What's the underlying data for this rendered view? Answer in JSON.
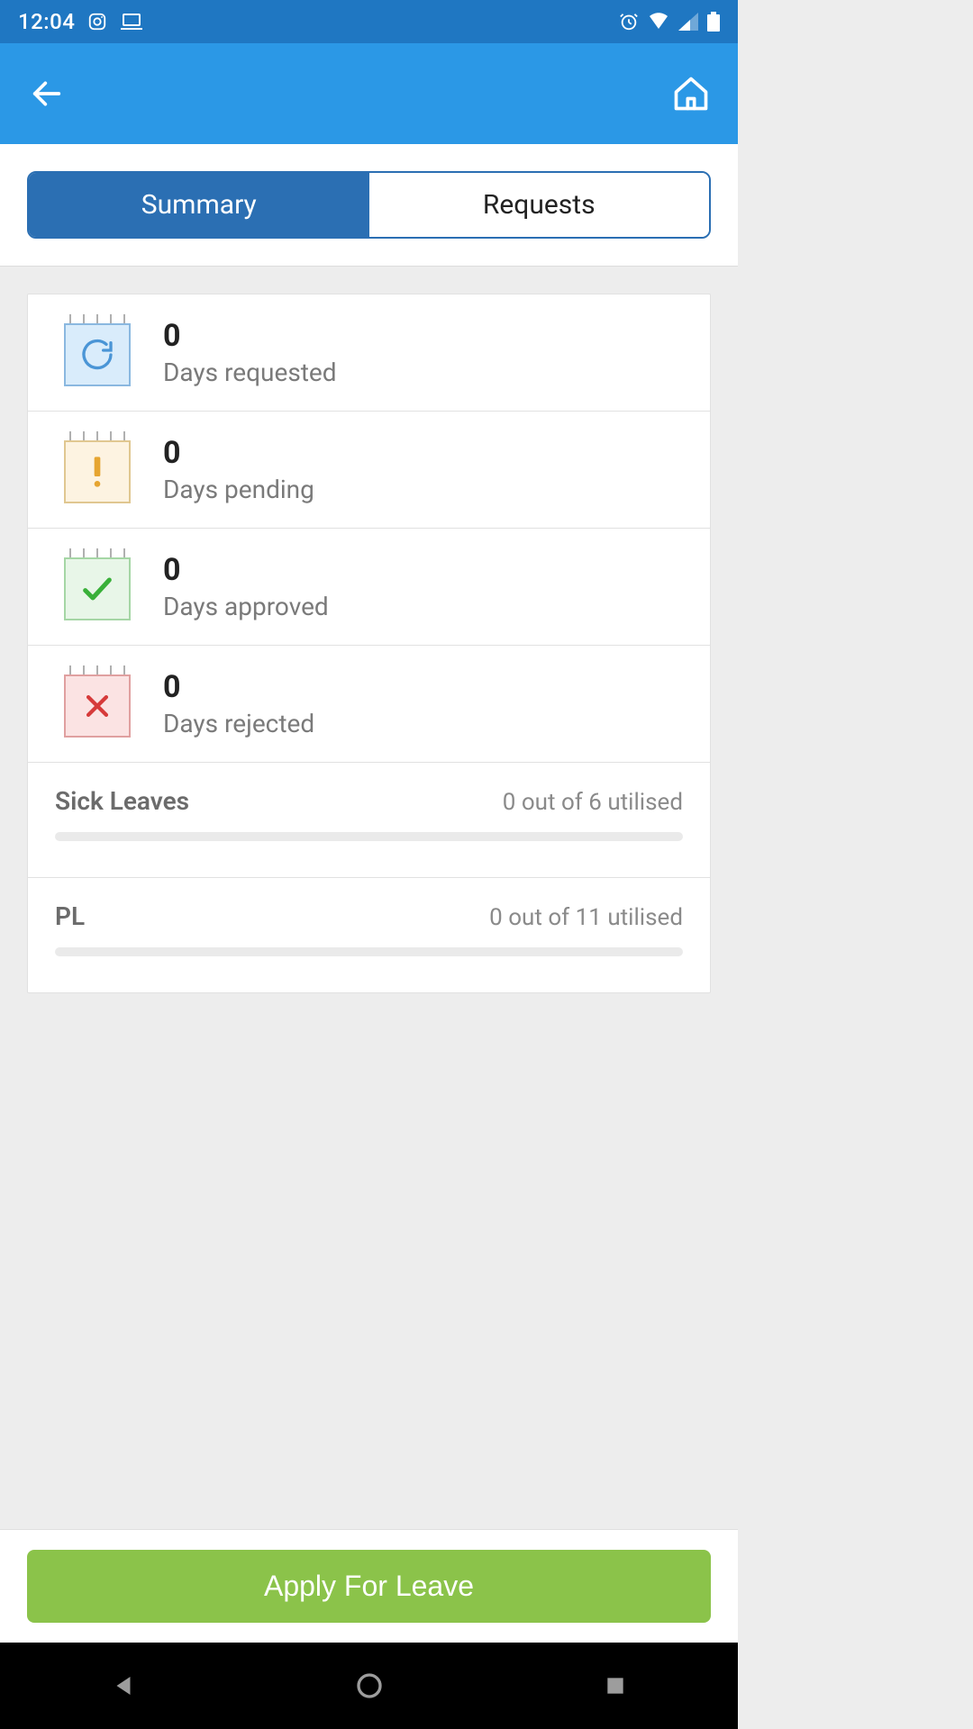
{
  "status_bar": {
    "time": "12:04"
  },
  "tabs": {
    "summary_label": "Summary",
    "requests_label": "Requests"
  },
  "stats": {
    "requested": {
      "value": "0",
      "label": "Days requested"
    },
    "pending": {
      "value": "0",
      "label": "Days pending"
    },
    "approved": {
      "value": "0",
      "label": "Days approved"
    },
    "rejected": {
      "value": "0",
      "label": "Days rejected"
    }
  },
  "leaves": [
    {
      "name": "Sick Leaves",
      "util": "0 out of 6 utilised"
    },
    {
      "name": "PL",
      "util": "0 out of 11 utilised"
    }
  ],
  "action": {
    "apply_label": "Apply For Leave"
  }
}
